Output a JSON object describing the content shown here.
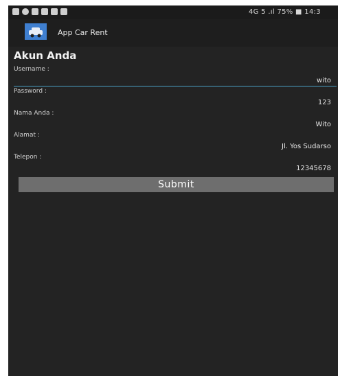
{
  "statusbar": {
    "left_icons": [
      "image-icon",
      "circle-icon",
      "gallery-icon",
      "message-icon",
      "message-icon",
      "chat-icon"
    ],
    "right_text": "4G 5 .ıl 75% ■ 14:3"
  },
  "appbar": {
    "title": "App Car Rent"
  },
  "page": {
    "title": "Akun Anda"
  },
  "form": {
    "username_label": "Username :",
    "username_value": "wito",
    "password_label": "Password :",
    "password_value": "123",
    "nama_label": "Nama Anda :",
    "nama_value": "Wito",
    "alamat_label": "Alamat :",
    "alamat_value": "Jl. Yos Sudarso",
    "telepon_label": "Telepon :",
    "telepon_value": "12345678",
    "submit_label": "Submit"
  },
  "colors": {
    "background": "#232323",
    "accent": "#4aa3c8",
    "button": "#6e6e6e"
  }
}
